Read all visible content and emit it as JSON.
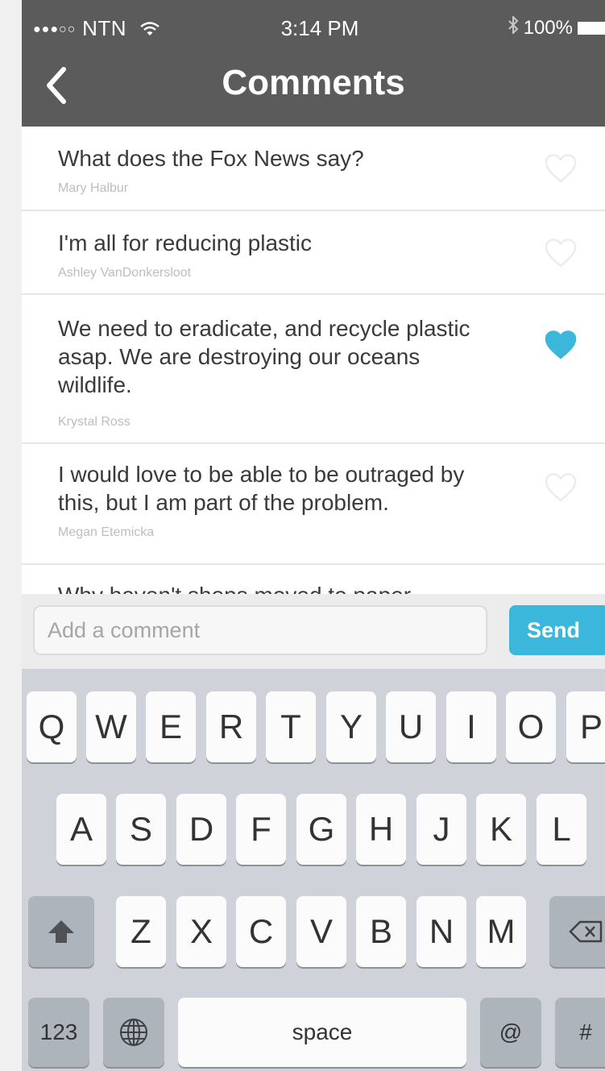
{
  "status_bar": {
    "signal": "●●●○○",
    "carrier": "NTN",
    "wifi": "ᯤ",
    "time": "3:14 PM",
    "bluetooth": "✱",
    "battery": "100%"
  },
  "header": {
    "title": "Comments"
  },
  "comments": [
    {
      "text": "What does the Fox News say?",
      "author": "Mary Halbur",
      "liked": false
    },
    {
      "text": "I'm all for reducing plastic",
      "author": "Ashley VanDonkersloot",
      "liked": false
    },
    {
      "text": "We need to eradicate, and recycle plastic asap. We are destroying our oceans wildlife.",
      "author": "Krystal Ross",
      "liked": true
    },
    {
      "text": "I would love to be able to be outraged by this, but I am part of the problem.",
      "author": "Megan Etemicka",
      "liked": false
    },
    {
      "text": "Why haven't shops moved to paper",
      "author": "",
      "liked": false
    }
  ],
  "compose": {
    "placeholder": "Add a comment",
    "send_label": "Send"
  },
  "keyboard": {
    "row1": [
      "Q",
      "W",
      "E",
      "R",
      "T",
      "Y",
      "U",
      "I",
      "O",
      "P"
    ],
    "row2": [
      "A",
      "S",
      "D",
      "F",
      "G",
      "H",
      "J",
      "K",
      "L"
    ],
    "row3": [
      "Z",
      "X",
      "C",
      "V",
      "B",
      "N",
      "M"
    ],
    "numbers_label": "123",
    "space_label": "space",
    "at_label": "@",
    "hash_label": "#"
  },
  "colors": {
    "header_bg": "#5b5b5b",
    "accent": "#3bb7dc",
    "heart_off": "#ececec",
    "keyboard_bg": "#cfd3d9"
  }
}
